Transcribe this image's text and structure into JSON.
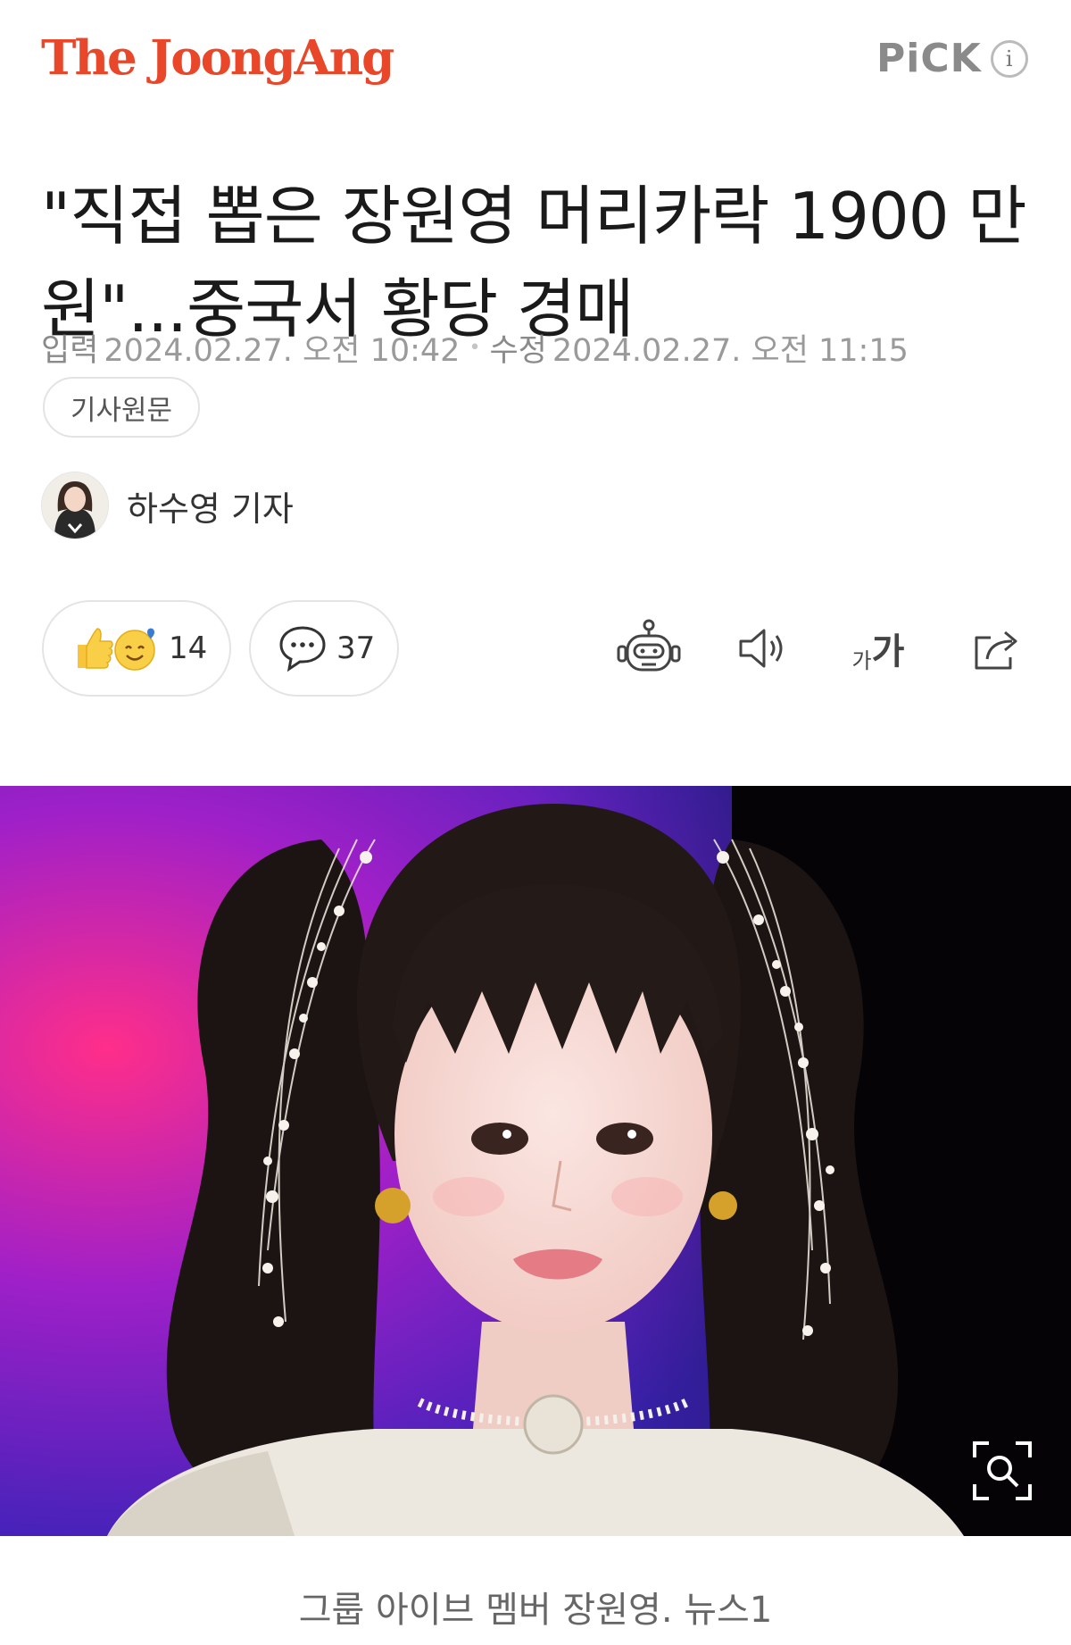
{
  "header": {
    "logo": "The JoongAng",
    "pick_label": "PiCK",
    "info_icon_label": "i"
  },
  "article": {
    "title": "\"직접 뽑은 장원영 머리카락 1900 만원\"...중국서 황당 경매",
    "published_label": "입력",
    "published": "2024.02.27. 오전 10:42",
    "modified_label": "수정",
    "modified": "2024.02.27. 오전 11:15",
    "original_button": "기사원문",
    "reporter": "하수영 기자"
  },
  "actions": {
    "reaction_count": "14",
    "comment_count": "37",
    "summary_icon": "robot-icon",
    "audio_icon": "speaker-icon",
    "font_size_icon": "font-size-icon",
    "font_small_glyph": "가",
    "font_large_glyph": "가",
    "share_icon": "share-icon"
  },
  "photo": {
    "caption": "그룹 아이브 멤버 장원영. 뉴스1",
    "zoom_icon": "zoom-icon"
  },
  "colors": {
    "brand": "#e8472a",
    "meta_text": "#9a9a9a",
    "border": "#e4e4e4"
  }
}
